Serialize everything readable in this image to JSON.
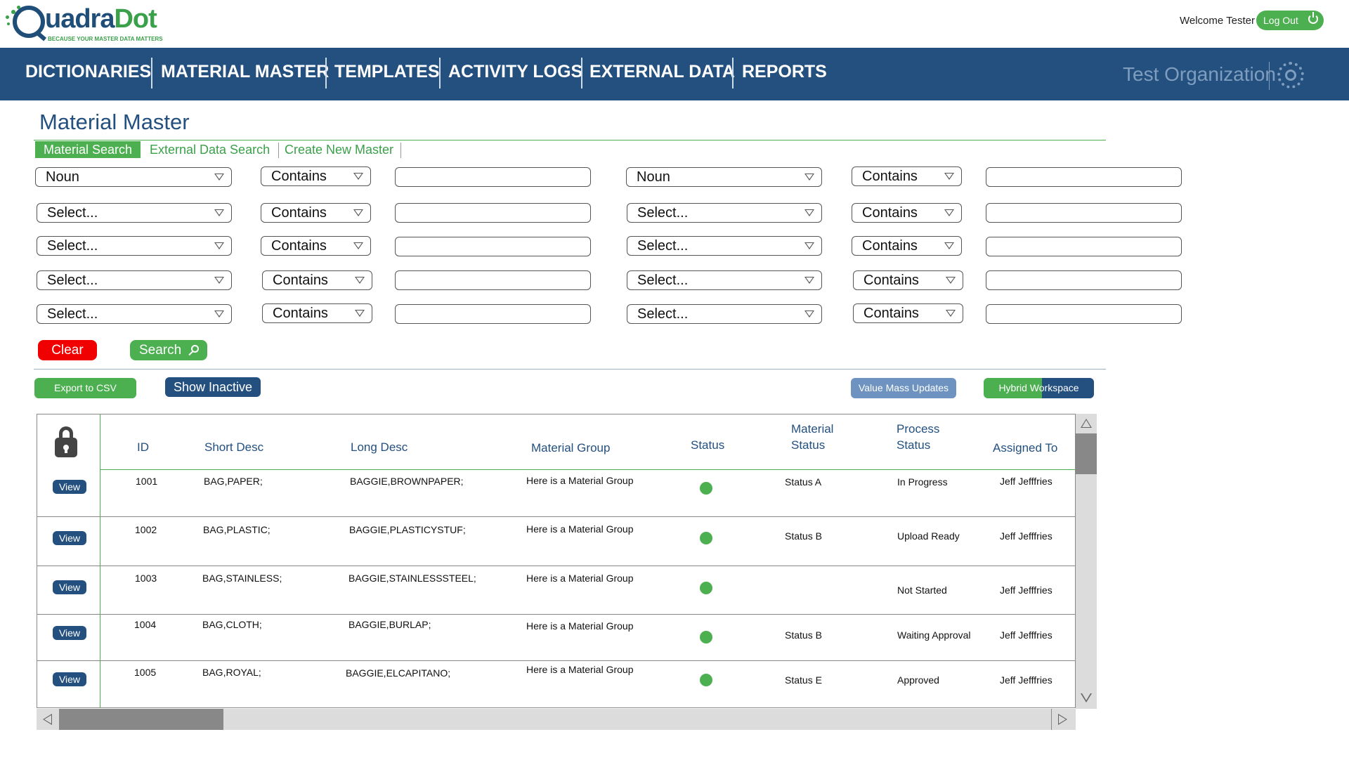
{
  "header": {
    "logo_main": "uadra",
    "logo_accent": "Dot",
    "logo_tagline": "BECAUSE YOUR MASTER DATA MATTERS",
    "welcome": "Welcome Tester",
    "logout_label": "Log Out",
    "logout_icon": "power-icon"
  },
  "nav": {
    "items": [
      "DICTIONARIES",
      "MATERIAL MASTER",
      "TEMPLATES",
      "ACTIVITY LOGS",
      "EXTERNAL DATA",
      "REPORTS"
    ],
    "organization": "Test Organization",
    "settings_icon": "gear-icon",
    "background_color": "#23507f"
  },
  "page": {
    "title": "Material Master",
    "tabs": [
      "Material Search",
      "External Data Search",
      "Create New Master"
    ],
    "active_tab": "Material Search"
  },
  "filters": {
    "left": [
      {
        "field": "Noun",
        "operator": "Contains",
        "value": ""
      },
      {
        "field": "Select...",
        "operator": "Contains",
        "value": ""
      },
      {
        "field": "Select...",
        "operator": "Contains",
        "value": ""
      },
      {
        "field": "Select...",
        "operator": "Contains",
        "value": ""
      },
      {
        "field": "Select...",
        "operator": "Contains",
        "value": ""
      }
    ],
    "right": [
      {
        "field": "Noun",
        "operator": "Contains",
        "value": ""
      },
      {
        "field": "Select...",
        "operator": "Contains",
        "value": ""
      },
      {
        "field": "Select...",
        "operator": "Contains",
        "value": ""
      },
      {
        "field": "Select...",
        "operator": "Contains",
        "value": ""
      },
      {
        "field": "Select...",
        "operator": "Contains",
        "value": ""
      }
    ]
  },
  "actions": {
    "clear": "Clear",
    "search": "Search",
    "export_csv": "Export to CSV",
    "show_inactive": "Show Inactive",
    "value_mass_updates": "Value Mass Updates",
    "hybrid_workspace": "Hybrid Workspace"
  },
  "table": {
    "lock_icon": "lock-icon",
    "columns": {
      "id": "ID",
      "short_desc": "Short Desc",
      "long_desc": "Long Desc",
      "material_group": "Material Group",
      "status": "Status",
      "material_status_1": "Material",
      "material_status_2": "Status",
      "process_status_1": "Process",
      "process_status_2": "Status",
      "assigned_to": "Assigned To"
    },
    "view_label": "View",
    "status_color": "#4caf50",
    "rows": [
      {
        "id": "1001",
        "short_desc": "BAG,PAPER;",
        "long_desc": "BAGGIE,BROWNPAPER;",
        "material_group": "Here is a Material Group",
        "material_status": "Status A",
        "process_status": "In Progress",
        "assigned_to": "Jeff Jefffries"
      },
      {
        "id": "1002",
        "short_desc": "BAG,PLASTIC;",
        "long_desc": "BAGGIE,PLASTICYSTUF;",
        "material_group": "Here is a Material Group",
        "material_status": "Status B",
        "process_status": "Upload Ready",
        "assigned_to": "Jeff Jefffries"
      },
      {
        "id": "1003",
        "short_desc": "BAG,STAINLESS;",
        "long_desc": "BAGGIE,STAINLESSSTEEL;",
        "material_group": "Here is a Material Group",
        "material_status": "",
        "process_status": "Not Started",
        "assigned_to": "Jeff Jefffries"
      },
      {
        "id": "1004",
        "short_desc": "BAG,CLOTH;",
        "long_desc": "BAGGIE,BURLAP;",
        "material_group": "Here is a Material Group",
        "material_status": "Status B",
        "process_status": "Waiting Approval",
        "assigned_to": "Jeff Jefffries"
      },
      {
        "id": "1005",
        "short_desc": "BAG,ROYAL;",
        "long_desc": "BAGGIE,ELCAPITANO;",
        "material_group": "Here is a Material Group",
        "material_status": "Status E",
        "process_status": "Approved",
        "assigned_to": "Jeff Jefffries"
      }
    ]
  }
}
